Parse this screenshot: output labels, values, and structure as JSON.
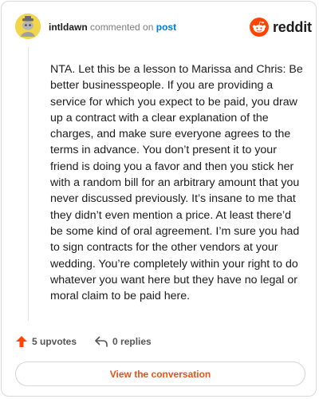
{
  "header": {
    "username": "intldawn",
    "action_text": "commented on",
    "post_link_label": "post"
  },
  "brand": {
    "name": "reddit",
    "icon": "reddit-snoo-icon",
    "color": "#ff4500"
  },
  "avatar": {
    "icon": "avatar-icon",
    "color": "#f3d54a"
  },
  "comment": {
    "body": "NTA. Let this be a lesson to Marissa and Chris: Be better businesspeople. If you are providing a service for which you expect to be paid, you draw up a contract with a clear explanation of the charges, and make sure everyone agrees to the terms in advance. You don’t present it to your friend is doing you a favor and then you stick her with a random bill for an arbitrary amount that you never discussed previously. It’s insane to me that they didn’t even mention a price. At least there’d be some kind of oral agreement. I’m sure you had to sign contracts for the other vendors at your wedding. You’re completely within your right to do whatever you want here but they have no legal or moral claim to be paid here."
  },
  "actions": {
    "upvotes_label": "5 upvotes",
    "upvote_icon": "upvote-arrow-icon",
    "upvote_color": "#ff4500",
    "replies_label": "0 replies",
    "reply_icon": "reply-arrow-icon"
  },
  "cta": {
    "label": "View the conversation",
    "color": "#e8501a"
  }
}
